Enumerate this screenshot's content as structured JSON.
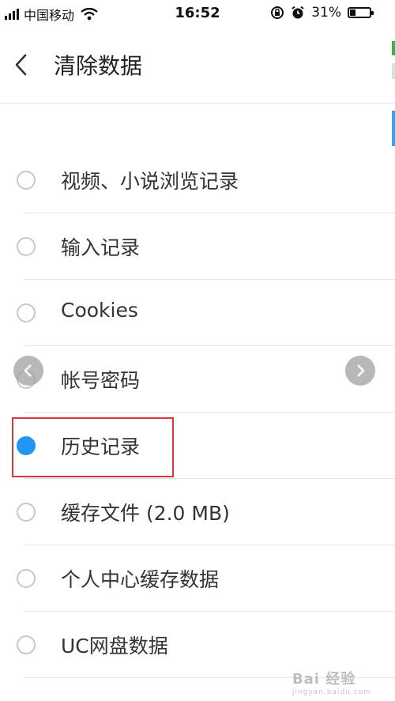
{
  "status_bar": {
    "carrier": "中国移动",
    "time": "16:52",
    "battery_percent": "31%",
    "battery_level": 0.31
  },
  "nav": {
    "back_icon": "chevron-left-icon",
    "title": "清除数据"
  },
  "options": [
    {
      "label": "视频、小说浏览记录",
      "checked": false
    },
    {
      "label": "输入记录",
      "checked": false
    },
    {
      "label": "Cookies",
      "checked": false
    },
    {
      "label": "帐号密码",
      "checked": false
    },
    {
      "label": "历史记录",
      "checked": true
    },
    {
      "label": "缓存文件 (2.0 MB)",
      "checked": false
    },
    {
      "label": "个人中心缓存数据",
      "checked": false
    },
    {
      "label": "UC网盘数据",
      "checked": false
    }
  ],
  "colors": {
    "accent": "#2196f3",
    "highlight_border": "#d9363e"
  },
  "watermark": {
    "text": "Bai 经验",
    "url": "jingyan.baidu.com"
  }
}
